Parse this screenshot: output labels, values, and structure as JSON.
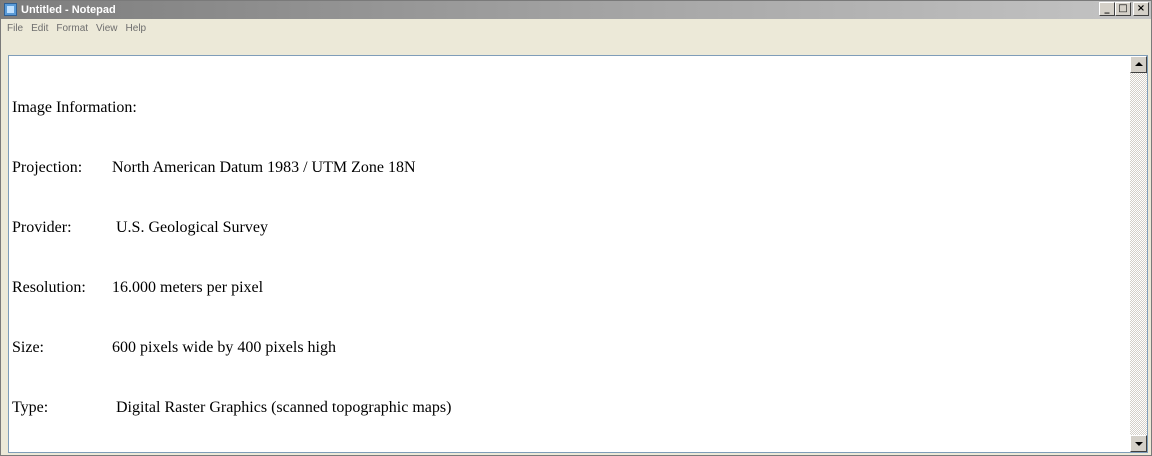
{
  "window": {
    "title": "Untitled - Notepad",
    "controls": {
      "minimize": "_",
      "maximize": "□",
      "close": "×"
    }
  },
  "menu": {
    "items": [
      "File",
      "Edit",
      "Format",
      "View",
      "Help"
    ]
  },
  "document": {
    "lines": [
      {
        "label": "Image Information:",
        "value": ""
      },
      {
        "label": "Projection:",
        "value": "North American Datum 1983 / UTM Zone 18N"
      },
      {
        "label": "Provider:",
        "value": "U.S. Geological Survey"
      },
      {
        "label": "Resolution:",
        "value": "16.000 meters per pixel"
      },
      {
        "label": "Size:",
        "value": "600 pixels wide by 400 pixels high"
      },
      {
        "label": "Type:",
        "value": "Digital Raster Graphics (scanned topographic maps)"
      }
    ]
  },
  "colors": {
    "titlebar_start": "#7d7d7d",
    "titlebar_end": "#c4c4c4",
    "menu_text": "#6e6e6e",
    "text": "#000000"
  }
}
